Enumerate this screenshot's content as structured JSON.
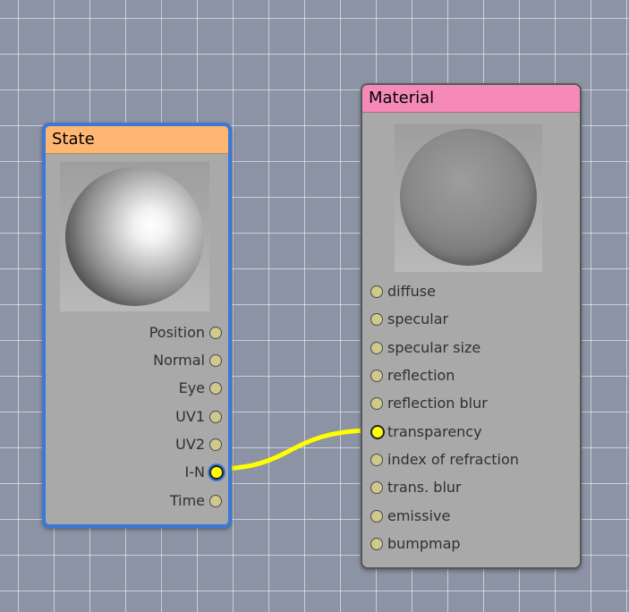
{
  "canvas": {
    "background": "#8b93a4",
    "grid_color": "#b4bac6"
  },
  "wire": {
    "color": "#ffff00",
    "from": "state.I-N",
    "to": "material.transparency"
  },
  "nodes": {
    "state": {
      "title": "State",
      "title_color": "#ffb673",
      "selected": true,
      "outputs": [
        "Position",
        "Normal",
        "Eye",
        "UV1",
        "UV2",
        "I-N",
        "Time"
      ],
      "connected_output": "I-N"
    },
    "material": {
      "title": "Material",
      "title_color": "#f58ab9",
      "inputs": [
        "diffuse",
        "specular",
        "specular size",
        "reflection",
        "reflection blur",
        "transparency",
        "index of refraction",
        "trans. blur",
        "emissive",
        "bumpmap"
      ],
      "connected_input": "transparency"
    }
  }
}
